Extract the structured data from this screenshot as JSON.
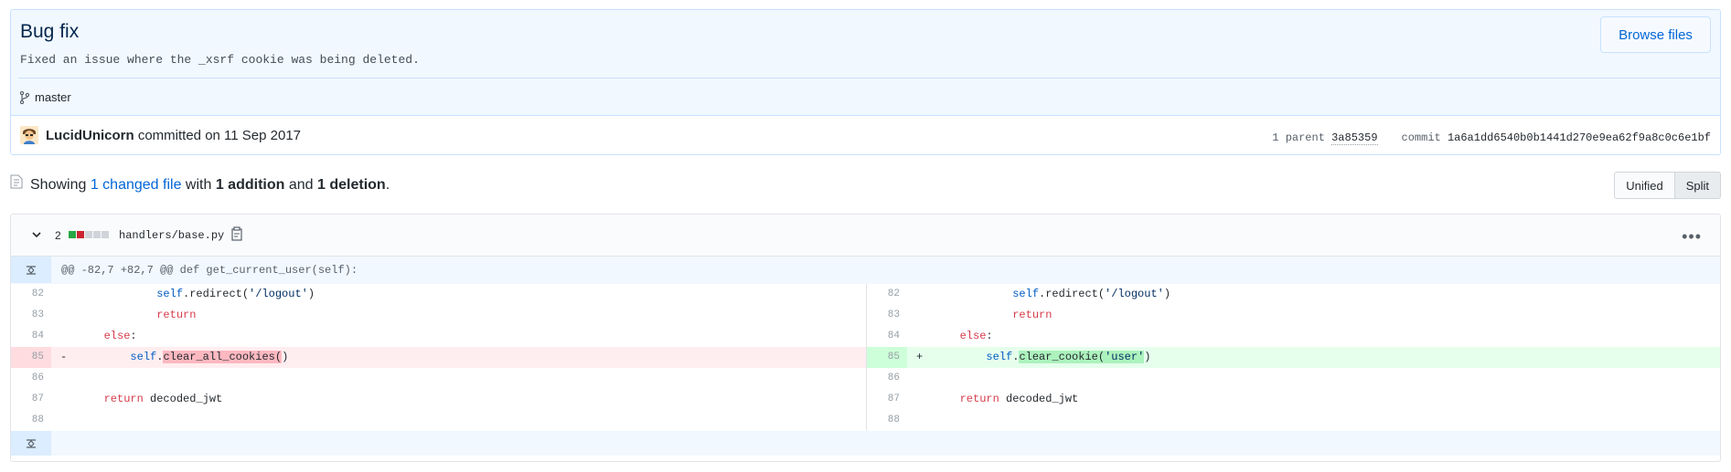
{
  "commit": {
    "title": "Bug fix",
    "description": "Fixed an issue where the _xsrf cookie was being deleted.",
    "browse_files_label": "Browse files",
    "branch": "master",
    "author": "LucidUnicorn",
    "committed_text": "committed on 11 Sep 2017",
    "parent_label": "1 parent",
    "parent_sha": "3a85359",
    "commit_label": "commit",
    "commit_sha": "1a6a1dd6540b0b1441d270e9ea62f9a8c0c6e1bf"
  },
  "summary": {
    "showing": "Showing",
    "changed_files": "1 changed file",
    "with": "with",
    "additions": "1 addition",
    "and": "and",
    "deletions": "1 deletion",
    "period": "."
  },
  "view_toggle": {
    "unified_label": "Unified",
    "split_label": "Split",
    "selected": "Split"
  },
  "file": {
    "change_count": "2",
    "name": "handlers/base.py",
    "hunk_header": "@@ -82,7 +82,7 @@ def get_current_user(self):",
    "diffstat_colors": [
      "#28a745",
      "#cb2431",
      "#d1d5da",
      "#d1d5da",
      "#d1d5da"
    ]
  },
  "left_lines": [
    {
      "num": "82",
      "indent": "                ",
      "type": "ctx"
    },
    {
      "num": "83",
      "indent": "                ",
      "type": "ctx"
    },
    {
      "num": "84",
      "indent": "        ",
      "type": "ctx"
    },
    {
      "num": "85",
      "indent": "            ",
      "type": "del",
      "marker": "-"
    },
    {
      "num": "86",
      "indent": "",
      "type": "ctx"
    },
    {
      "num": "87",
      "indent": "        ",
      "type": "ctx"
    },
    {
      "num": "88",
      "indent": "",
      "type": "ctx"
    }
  ],
  "right_lines": [
    {
      "num": "82",
      "type": "ctx"
    },
    {
      "num": "83",
      "type": "ctx"
    },
    {
      "num": "84",
      "type": "ctx"
    },
    {
      "num": "85",
      "type": "add",
      "marker": "+"
    },
    {
      "num": "86",
      "type": "ctx"
    },
    {
      "num": "87",
      "type": "ctx"
    },
    {
      "num": "88",
      "type": "ctx"
    }
  ],
  "code": {
    "self": "self",
    "redirect_call": ".redirect(",
    "logout_str": "'/logout'",
    "close_paren": ")",
    "return_kw": "return",
    "else_kw": "else",
    "colon": ":",
    "clear_all": "clear_all_cookies(",
    "clear_cookie": "clear_cookie(",
    "user_str": "'user'",
    "dot": ".",
    "decoded": " decoded_jwt"
  }
}
